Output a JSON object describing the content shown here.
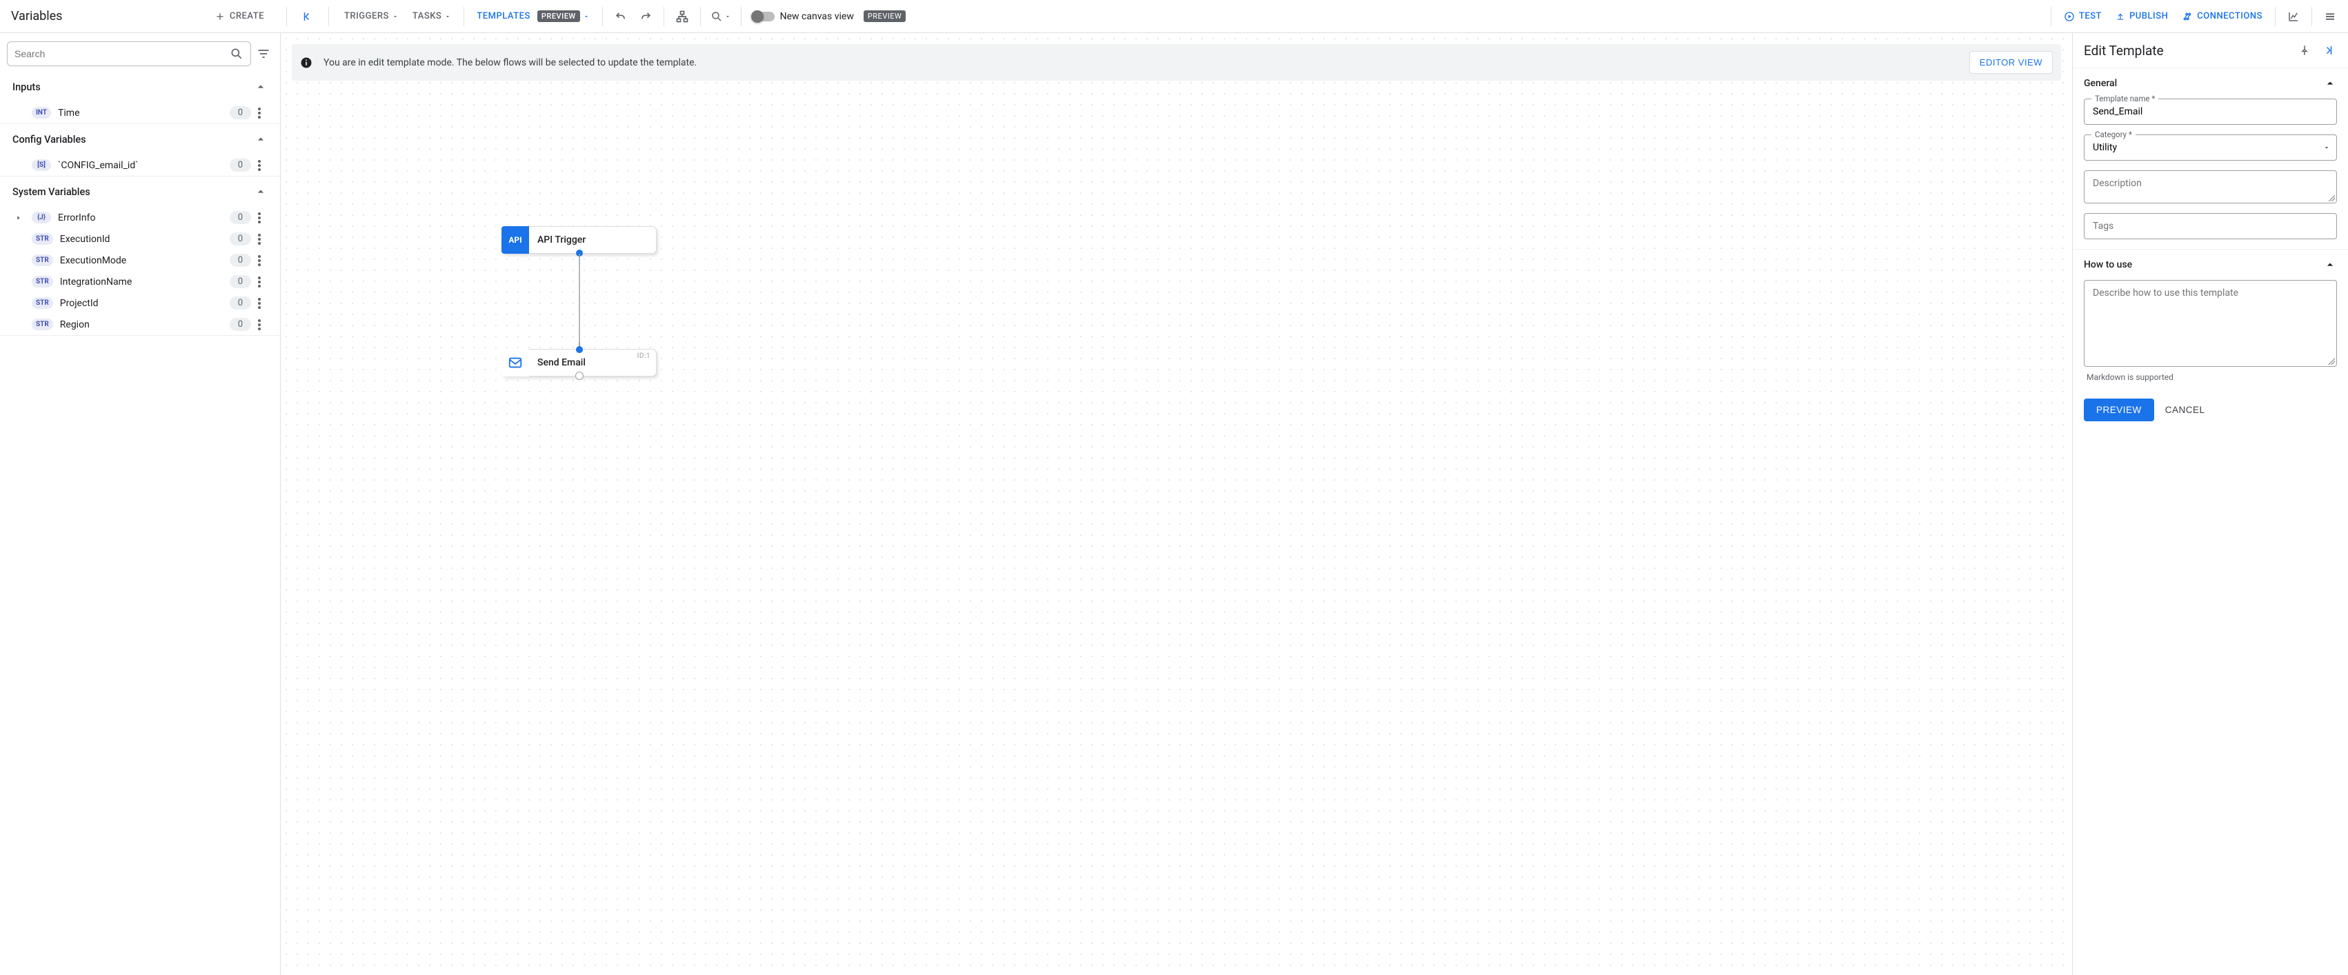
{
  "topbar": {
    "left_title": "Variables",
    "create_label": "CREATE",
    "triggers_label": "TRIGGERS",
    "tasks_label": "TASKS",
    "templates_label": "TEMPLATES",
    "preview_badge": "PREVIEW",
    "new_canvas_label": "New canvas view",
    "test_label": "TEST",
    "publish_label": "PUBLISH",
    "connections_label": "CONNECTIONS"
  },
  "sidebar": {
    "search_placeholder": "Search",
    "sections": {
      "inputs": {
        "title": "Inputs",
        "items": [
          {
            "type": "INT",
            "name": "Time",
            "count": "0"
          }
        ]
      },
      "config": {
        "title": "Config Variables",
        "items": [
          {
            "type": "[S]",
            "name": "`CONFIG_email_id`",
            "count": "0"
          }
        ]
      },
      "system": {
        "title": "System Variables",
        "items": [
          {
            "type": "{J}",
            "name": "ErrorInfo",
            "count": "0",
            "expandable": true
          },
          {
            "type": "STR",
            "name": "ExecutionId",
            "count": "0"
          },
          {
            "type": "STR",
            "name": "ExecutionMode",
            "count": "0"
          },
          {
            "type": "STR",
            "name": "IntegrationName",
            "count": "0"
          },
          {
            "type": "STR",
            "name": "ProjectId",
            "count": "0"
          },
          {
            "type": "STR",
            "name": "Region",
            "count": "0"
          }
        ]
      }
    }
  },
  "canvas": {
    "notice_text": "You are in edit template mode. The below flows will be selected to update the template.",
    "editor_view_label": "EDITOR VIEW",
    "nodes": {
      "trigger": {
        "label": "API Trigger",
        "icon_text": "API"
      },
      "task": {
        "label": "Send Email",
        "id_label": "ID:1"
      }
    }
  },
  "right": {
    "title": "Edit Template",
    "general": {
      "title": "General",
      "template_name_label": "Template name *",
      "template_name_value": "Send_Email",
      "category_label": "Category *",
      "category_value": "Utility",
      "description_placeholder": "Description",
      "tags_placeholder": "Tags"
    },
    "howto": {
      "title": "How to use",
      "placeholder": "Describe how to use this template",
      "helper": "Markdown is supported"
    },
    "actions": {
      "preview": "PREVIEW",
      "cancel": "CANCEL"
    }
  }
}
